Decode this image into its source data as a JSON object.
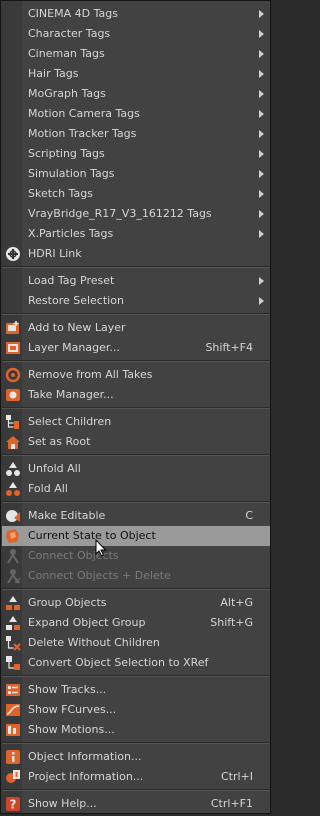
{
  "menu": {
    "items": [
      {
        "label": "CINEMA 4D Tags",
        "submenu": true,
        "icon": "none"
      },
      {
        "label": "Character Tags",
        "submenu": true,
        "icon": "none"
      },
      {
        "label": "Cineman Tags",
        "submenu": true,
        "icon": "none"
      },
      {
        "label": "Hair Tags",
        "submenu": true,
        "icon": "none"
      },
      {
        "label": "MoGraph Tags",
        "submenu": true,
        "icon": "none"
      },
      {
        "label": "Motion Camera Tags",
        "submenu": true,
        "icon": "none"
      },
      {
        "label": "Motion Tracker Tags",
        "submenu": true,
        "icon": "none"
      },
      {
        "label": "Scripting Tags",
        "submenu": true,
        "icon": "none"
      },
      {
        "label": "Simulation Tags",
        "submenu": true,
        "icon": "none"
      },
      {
        "label": "Sketch Tags",
        "submenu": true,
        "icon": "none"
      },
      {
        "label": "VrayBridge_R17_V3_161212 Tags",
        "submenu": true,
        "icon": "none"
      },
      {
        "label": "X.Particles Tags",
        "submenu": true,
        "icon": "none"
      },
      {
        "label": "HDRI Link",
        "submenu": false,
        "icon": "hdri-link-icon"
      },
      {
        "label": "Load Tag Preset",
        "submenu": true,
        "icon": "none"
      },
      {
        "label": "Restore Selection",
        "submenu": true,
        "icon": "none"
      },
      {
        "label": "Add to New Layer",
        "icon": "add-layer-icon"
      },
      {
        "label": "Layer Manager...",
        "shortcut": "Shift+F4",
        "icon": "layer-manager-icon"
      },
      {
        "label": "Remove from All Takes",
        "icon": "remove-takes-icon"
      },
      {
        "label": "Take Manager...",
        "icon": "take-manager-icon"
      },
      {
        "label": "Select Children",
        "icon": "select-children-icon"
      },
      {
        "label": "Set as Root",
        "icon": "set-root-icon"
      },
      {
        "label": "Unfold All",
        "icon": "unfold-all-icon"
      },
      {
        "label": "Fold All",
        "icon": "fold-all-icon"
      },
      {
        "label": "Make Editable",
        "shortcut": "C",
        "icon": "make-editable-icon"
      },
      {
        "label": "Current State to Object",
        "highlighted": true,
        "icon": "current-state-icon"
      },
      {
        "label": "Connect Objects",
        "disabled": true,
        "icon": "connect-objects-icon"
      },
      {
        "label": "Connect Objects + Delete",
        "disabled": true,
        "icon": "connect-delete-icon"
      },
      {
        "label": "Group Objects",
        "shortcut": "Alt+G",
        "icon": "group-objects-icon"
      },
      {
        "label": "Expand Object Group",
        "shortcut": "Shift+G",
        "icon": "expand-group-icon"
      },
      {
        "label": "Delete Without Children",
        "icon": "delete-no-children-icon"
      },
      {
        "label": "Convert Object Selection to XRef",
        "icon": "xref-icon"
      },
      {
        "label": "Show Tracks...",
        "icon": "tracks-icon"
      },
      {
        "label": "Show FCurves...",
        "icon": "fcurves-icon"
      },
      {
        "label": "Show Motions...",
        "icon": "motions-icon"
      },
      {
        "label": "Object Information...",
        "icon": "object-info-icon"
      },
      {
        "label": "Project Information...",
        "shortcut": "Ctrl+I",
        "icon": "project-info-icon"
      },
      {
        "label": "Show Help...",
        "shortcut": "Ctrl+F1",
        "icon": "help-icon"
      }
    ]
  },
  "colors": {
    "menu_bg": "#424242",
    "highlight": "#9a9a9a",
    "disabled_text": "#7a7a7a",
    "icon_orange": "#e0632a",
    "icon_white": "#e6e6e6"
  }
}
